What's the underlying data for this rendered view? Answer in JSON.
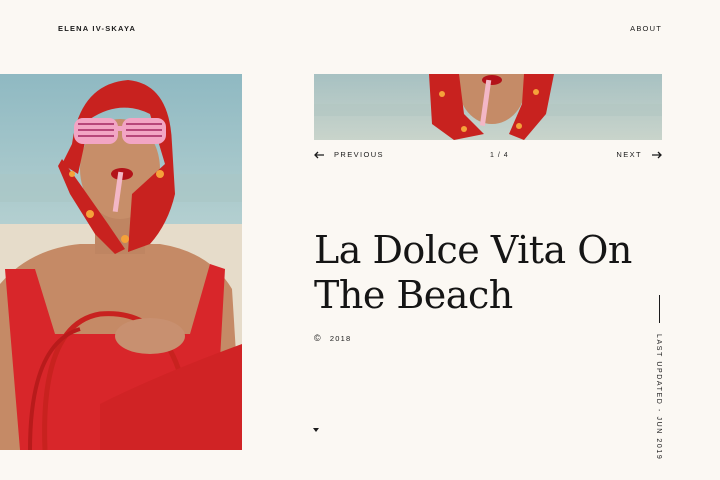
{
  "header": {
    "brand": "ELENA IV-SKAYA",
    "about_label": "ABOUT"
  },
  "pager": {
    "previous_label": "PREVIOUS",
    "next_label": "NEXT",
    "counter": "1 / 4"
  },
  "article": {
    "title": "La Dolce Vita On The Beach",
    "year": "2018",
    "copyright_symbol": "©",
    "last_updated": "LAST UPDATED - JUN 2019"
  },
  "colors": {
    "background": "#fbf8f3",
    "text": "#1b1b1b",
    "accent_red": "#d8262a",
    "sky": "#9ec2c8",
    "skin": "#c98f6c"
  },
  "icons": {
    "prev": "arrow-left-icon",
    "next": "arrow-right-icon",
    "scroll": "caret-down-icon",
    "copyright": "copyright-icon"
  }
}
